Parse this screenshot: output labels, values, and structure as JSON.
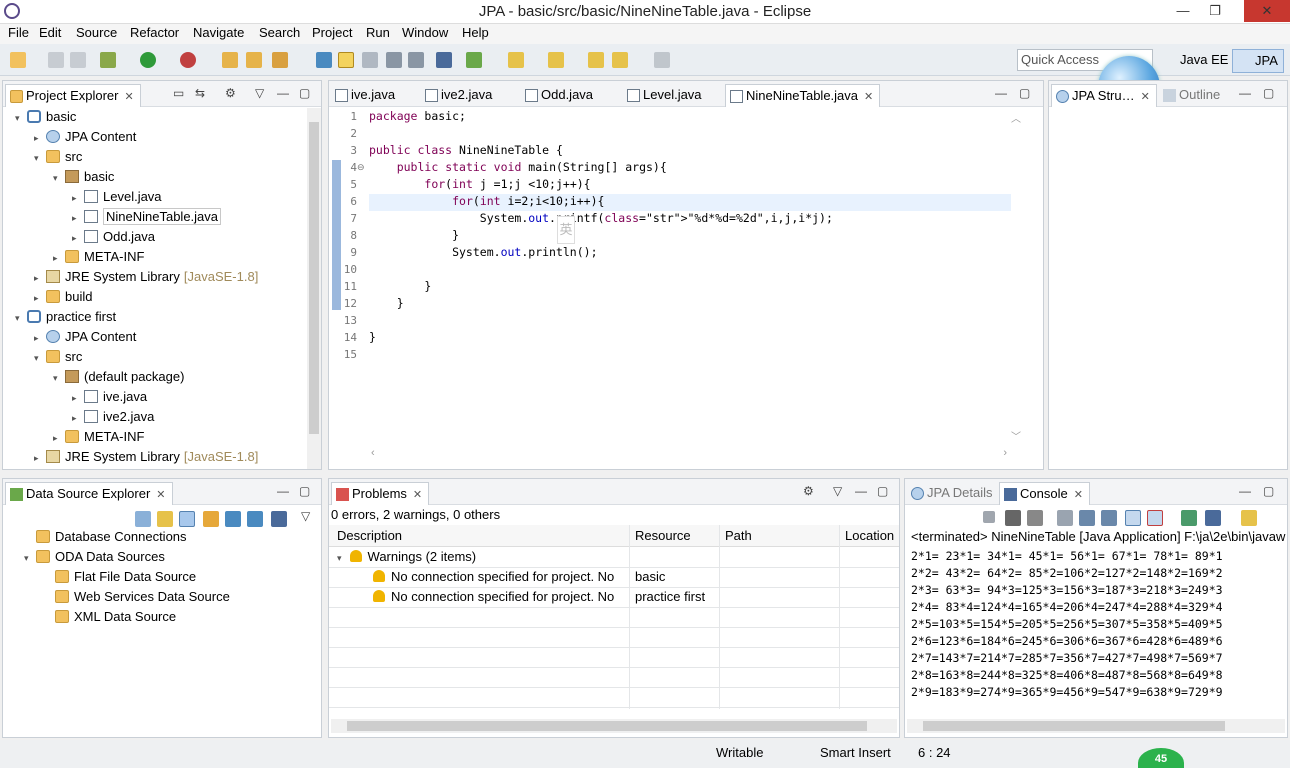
{
  "window": {
    "title": "JPA - basic/src/basic/NineNineTable.java - Eclipse",
    "min": "—",
    "max": "❐",
    "close": "✕"
  },
  "menu": [
    "File",
    "Edit",
    "Source",
    "Refactor",
    "Navigate",
    "Search",
    "Project",
    "Run",
    "Window",
    "Help"
  ],
  "toolbar": {
    "quick_access": "Quick Access",
    "perspectives": [
      "Java EE",
      "JPA"
    ]
  },
  "project_explorer": {
    "tab": "Project Explorer",
    "tree": [
      {
        "label": "basic",
        "icon": "project-icon",
        "arrow": "▾"
      },
      {
        "label": "JPA Content",
        "icon": "jpa-icon",
        "arrow": "▸"
      },
      {
        "label": "src",
        "icon": "folder-icon",
        "arrow": "▾"
      },
      {
        "label": "basic",
        "icon": "package-icon",
        "arrow": "▾"
      },
      {
        "label": "Level.java",
        "icon": "java-file-icon",
        "arrow": "▸"
      },
      {
        "label": "NineNineTable.java",
        "icon": "java-file-icon",
        "arrow": "▸"
      },
      {
        "label": "Odd.java",
        "icon": "java-file-icon",
        "arrow": "▸"
      },
      {
        "label": "META-INF",
        "icon": "folder-icon",
        "arrow": "▸"
      },
      {
        "label": "JRE System Library",
        "extra": "[JavaSE-1.8]",
        "icon": "library-icon",
        "arrow": "▸"
      },
      {
        "label": "build",
        "icon": "folder-icon",
        "arrow": "▸"
      },
      {
        "label": "practice first",
        "icon": "project-icon",
        "arrow": "▾"
      },
      {
        "label": "JPA Content",
        "icon": "jpa-icon",
        "arrow": "▸"
      },
      {
        "label": "src",
        "icon": "folder-icon",
        "arrow": "▾"
      },
      {
        "label": "(default package)",
        "icon": "package-icon",
        "arrow": "▾"
      },
      {
        "label": "ive.java",
        "icon": "java-file-icon",
        "arrow": "▸"
      },
      {
        "label": "ive2.java",
        "icon": "java-file-icon",
        "arrow": "▸"
      },
      {
        "label": "META-INF",
        "icon": "folder-icon",
        "arrow": "▸"
      },
      {
        "label": "JRE System Library",
        "extra": "[JavaSE-1.8]",
        "icon": "library-icon",
        "arrow": "▸"
      }
    ]
  },
  "editor": {
    "tabs": [
      "ive.java",
      "ive2.java",
      "Odd.java",
      "Level.java",
      "NineNineTable.java"
    ],
    "active_tab": "NineNineTable.java",
    "line_numbers": [
      "1",
      "2",
      "3",
      "4",
      "5",
      "6",
      "7",
      "8",
      "9",
      "10",
      "11",
      "12",
      "13",
      "14",
      "15"
    ],
    "lines": [
      "package basic;",
      "",
      "public class NineNineTable {",
      "    public static void main(String[] args){",
      "        for(int j =1;j <10;j++){",
      "            for(int i=2;i<10;i++){",
      "                System.out.printf(\"%d*%d=%2d\",i,j,i*j);",
      "            }",
      "            System.out.println();",
      "",
      "        }",
      "    }",
      "",
      "}",
      ""
    ],
    "ime_char": "英"
  },
  "outline": {
    "tabs": [
      "JPA Stru…",
      "Outline"
    ]
  },
  "data_source_explorer": {
    "tab": "Data Source Explorer",
    "tree": [
      {
        "label": "Database Connections",
        "arrow": ""
      },
      {
        "label": "ODA Data Sources",
        "arrow": "▾"
      },
      {
        "label": "Flat File Data Source",
        "arrow": ""
      },
      {
        "label": "Web Services Data Source",
        "arrow": ""
      },
      {
        "label": "XML Data Source",
        "arrow": ""
      }
    ]
  },
  "problems": {
    "tab": "Problems",
    "summary": "0 errors, 2 warnings, 0 others",
    "columns": [
      "Description",
      "Resource",
      "Path",
      "Location"
    ],
    "group": "Warnings (2 items)",
    "rows": [
      {
        "description": "No connection specified for project. No",
        "resource": "basic"
      },
      {
        "description": "No connection specified for project. No",
        "resource": "practice first"
      }
    ]
  },
  "console": {
    "tabs": [
      "JPA Details",
      "Console"
    ],
    "header": "<terminated> NineNineTable [Java Application] F:\\ja\\2e\\bin\\javaw",
    "lines": [
      "2*1= 23*1= 34*1= 45*1= 56*1= 67*1= 78*1= 89*1",
      "2*2= 43*2= 64*2= 85*2=106*2=127*2=148*2=169*2",
      "2*3= 63*3= 94*3=125*3=156*3=187*3=218*3=249*3",
      "2*4= 83*4=124*4=165*4=206*4=247*4=288*4=329*4",
      "2*5=103*5=154*5=205*5=256*5=307*5=358*5=409*5",
      "2*6=123*6=184*6=245*6=306*6=367*6=428*6=489*6",
      "2*7=143*7=214*7=285*7=356*7=427*7=498*7=569*7",
      "2*8=163*8=244*8=325*8=406*8=487*8=568*8=649*8",
      "2*9=183*9=274*9=365*9=456*9=547*9=638*9=729*9"
    ]
  },
  "status": {
    "writable": "Writable",
    "insert_mode": "Smart Insert",
    "position": "6 : 24",
    "badge": "45"
  }
}
